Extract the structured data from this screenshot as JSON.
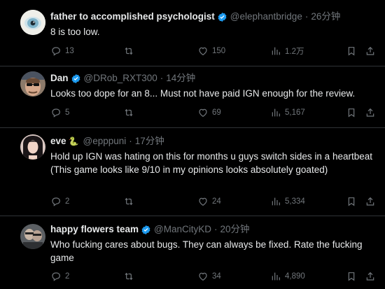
{
  "tweets": [
    {
      "name": "father to accomplished psychologist",
      "handle": "@elephantbridge",
      "sep": "·",
      "time": "26分钟",
      "text": "8 is too low.",
      "replies": "13",
      "reposts": "",
      "likes": "150",
      "views": "1.2万"
    },
    {
      "name": "Dan",
      "handle": "@DRob_RXT300",
      "sep": "·",
      "time": "14分钟",
      "text": "Looks too dope for an 8... Must not have paid IGN enough for the review.",
      "replies": "5",
      "reposts": "",
      "likes": "69",
      "views": "5,167"
    },
    {
      "name": "eve",
      "name_emoji": "🐍",
      "handle": "@epppuni",
      "sep": "·",
      "time": "17分钟",
      "text": "Hold up IGN was hating on this for months u guys switch sides in a heartbeat\n(This game looks like 9/10 in my opinions looks absolutely goated)",
      "replies": "2",
      "reposts": "",
      "likes": "24",
      "views": "5,334"
    },
    {
      "name": "happy flowers team",
      "handle": "@ManCityKD",
      "sep": "·",
      "time": "20分钟",
      "text": "Who fucking cares about bugs. They can always be fixed. Rate the fucking game",
      "replies": "2",
      "reposts": "",
      "likes": "34",
      "views": "4,890"
    }
  ],
  "icons": {
    "reply": "speech-bubble-icon",
    "repost": "repost-arrows-icon",
    "like": "heart-icon",
    "views": "bar-chart-icon",
    "bookmark": "bookmark-icon",
    "share": "share-upload-icon",
    "verified": "verified-badge-icon"
  },
  "colors": {
    "background": "#000000",
    "text": "#e7e9ea",
    "muted": "#71767b",
    "verified": "#1d9bf0",
    "divider": "#2f3336"
  }
}
